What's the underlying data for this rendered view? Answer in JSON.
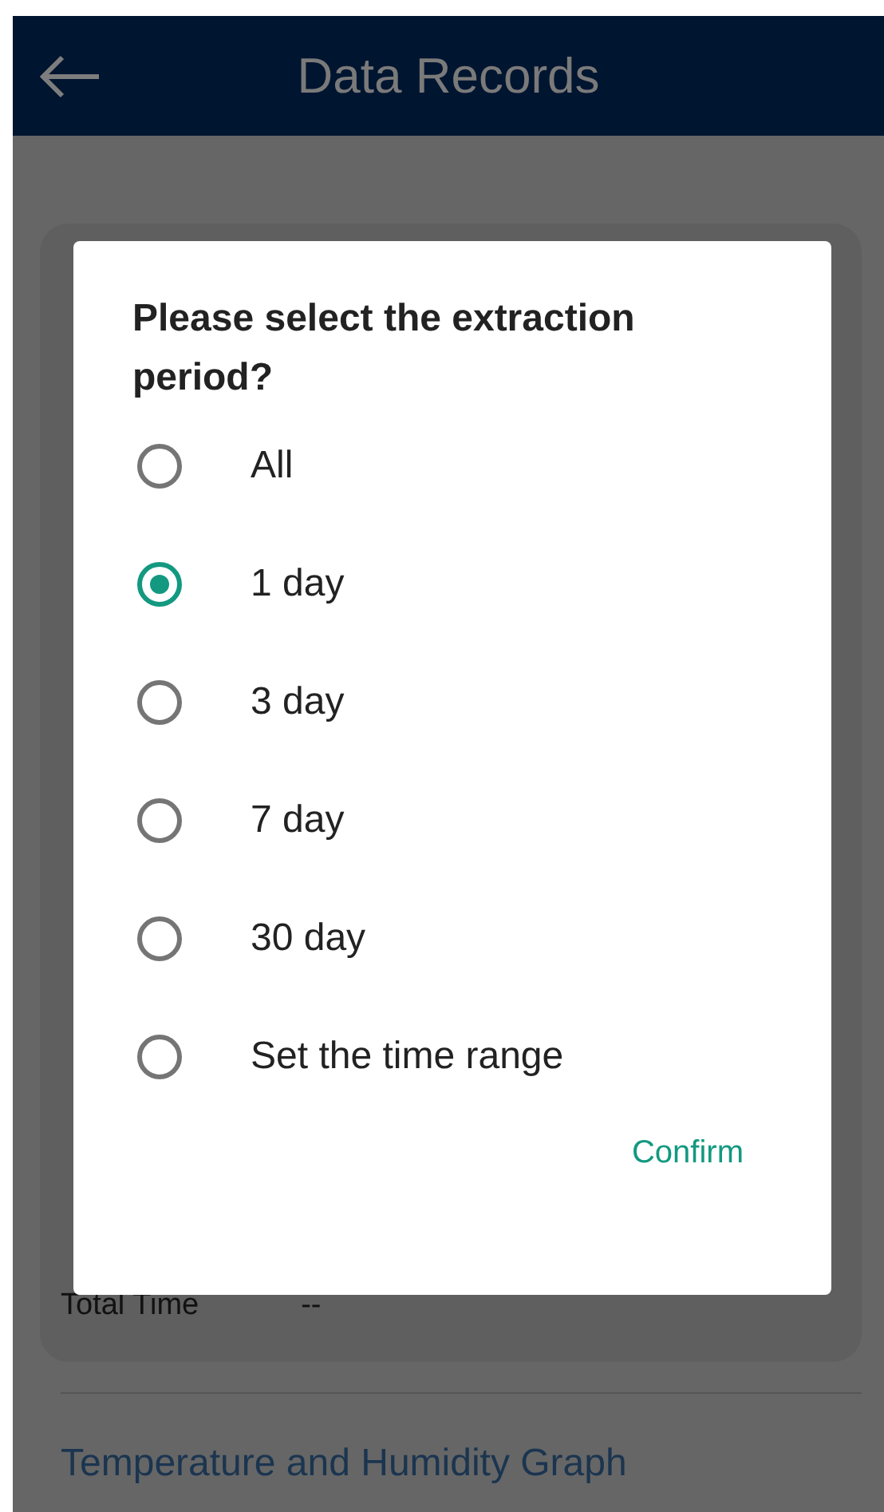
{
  "app_bar": {
    "title": "Data Records"
  },
  "record_card": {
    "rows": [
      {
        "label": "Total Time",
        "value": "--"
      }
    ]
  },
  "graph_section": {
    "heading": "Temperature and Humidity Graph"
  },
  "dialog": {
    "title": "Please select the extraction period?",
    "options": [
      {
        "label": "All",
        "selected": false
      },
      {
        "label": "1 day",
        "selected": true
      },
      {
        "label": "3 day",
        "selected": false
      },
      {
        "label": "7 day",
        "selected": false
      },
      {
        "label": "30 day",
        "selected": false
      },
      {
        "label": "Set the time range",
        "selected": false
      }
    ],
    "confirm": "Confirm"
  }
}
